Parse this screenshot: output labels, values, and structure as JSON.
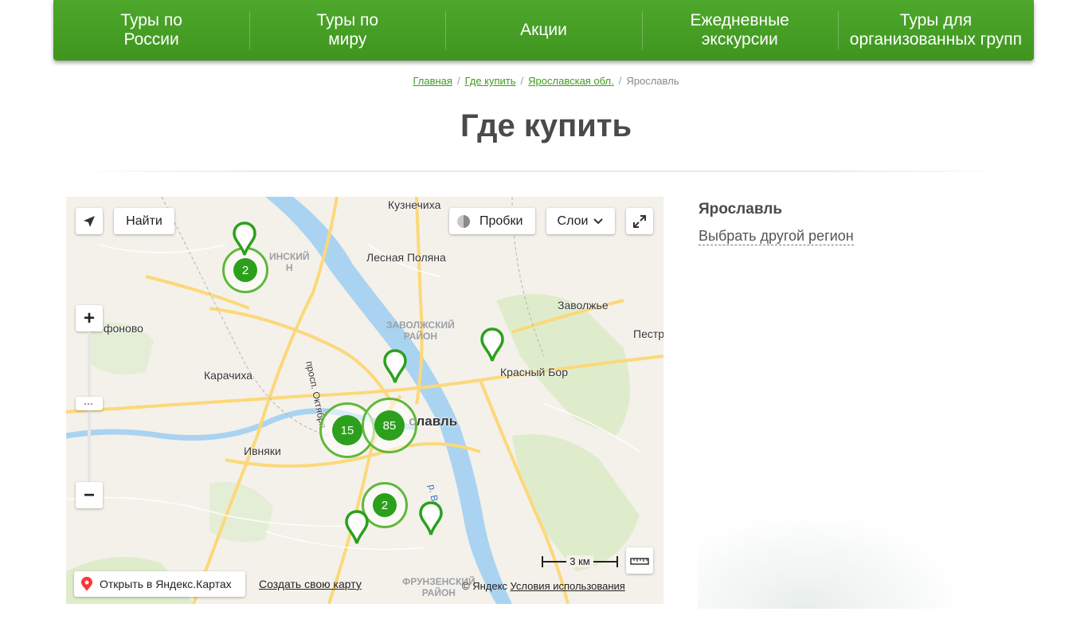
{
  "nav": [
    {
      "label": "Туры по\nРоссии"
    },
    {
      "label": "Туры по\nмиру"
    },
    {
      "label": "Акции"
    },
    {
      "label": "Ежедневные\nэкскурсии"
    },
    {
      "label": "Туры для\nорганизованных групп"
    }
  ],
  "breadcrumb": {
    "items": [
      "Главная",
      "Где купить",
      "Ярославская обл."
    ],
    "current": "Ярославль",
    "separator": "/"
  },
  "page_title": "Где купить",
  "map": {
    "locate_button": "Найти",
    "traffic_button": "Пробки",
    "layers_button": "Слои",
    "zoom_in": "+",
    "zoom_out": "−",
    "scale": "3 км",
    "open_in_yandex": "Открыть в Яндекс.Картах",
    "create_map": "Создать свою карту",
    "copyright": "© Яндекс",
    "terms": "Условия использования",
    "labels": {
      "kuznechikha": "Кузнечиха",
      "lesnaya_polyana": "Лесная Поляна",
      "zavolzhye": "Заволжье",
      "pestr": "Пестр",
      "fonovo": "фоново",
      "karachikha": "Карачиха",
      "krasny_bor": "Красный Бор",
      "ivnyaki": "Ивняки",
      "yaroslavl": "славль",
      "prosp_oktyabrya": "просп. Октября",
      "volga": "р. Волга",
      "dist_zavolzhsky": "ЗАВОЛЖСКИЙ\nРАЙОН",
      "dist_dzerzhinsky": "ИНСКИЙ\nН",
      "dist_frunzensky": "ФРУНЗЕНСКИЙ\nРАЙОН"
    },
    "clusters": [
      {
        "count": "2"
      },
      {
        "count": "15"
      },
      {
        "count": "85"
      },
      {
        "count": "2"
      }
    ],
    "colors": {
      "accent": "#2ca01c",
      "river": "#aad3f2",
      "road": "#fcd87a"
    }
  },
  "sidebar": {
    "region": "Ярославль",
    "change_region": "Выбрать другой регион"
  },
  "theme": {
    "nav_green": "#4ea82c",
    "link_green": "#3f9c1e"
  }
}
